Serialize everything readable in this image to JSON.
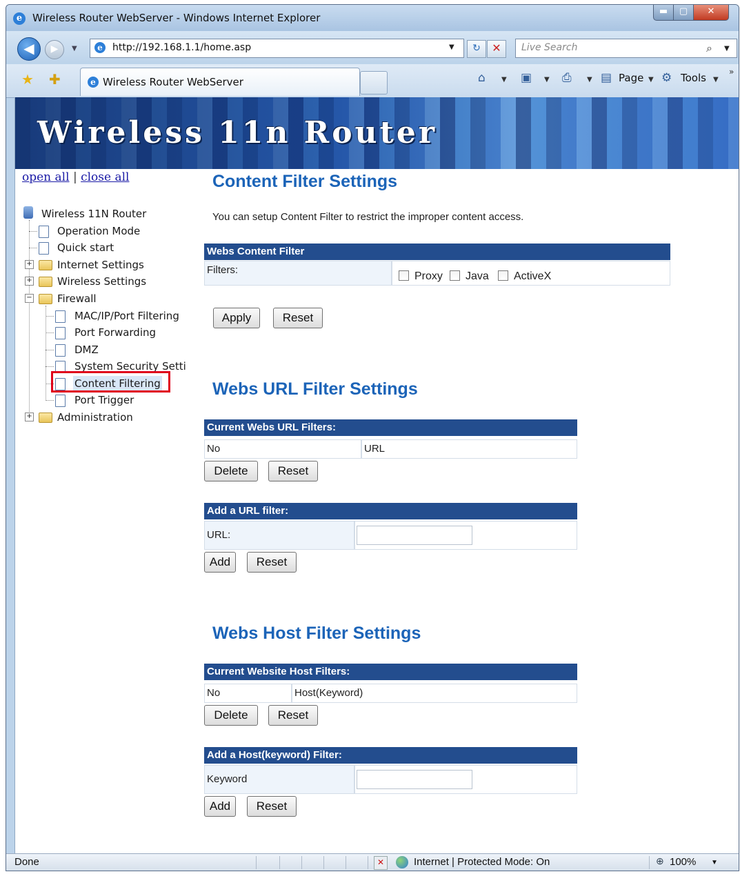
{
  "window": {
    "title": "Wireless Router WebServer - Windows Internet Explorer",
    "min_glyph": "▬",
    "max_glyph": "▢",
    "close_glyph": "✕"
  },
  "address_bar": {
    "url": "http://192.168.1.1/home.asp",
    "search_placeholder": "Live Search"
  },
  "tab": {
    "label": "Wireless Router WebServer"
  },
  "command_bar": {
    "page_label": "Page",
    "tools_label": "Tools"
  },
  "banner": {
    "title": "Wireless 11n Router"
  },
  "sidebar": {
    "open_all": "open all",
    "separator": "|",
    "close_all": "close all",
    "root": "Wireless 11N Router",
    "items": {
      "operation_mode": "Operation Mode",
      "quick_start": "Quick start",
      "internet_settings": "Internet Settings",
      "wireless_settings": "Wireless Settings",
      "firewall": "Firewall",
      "mac_ip_port": "MAC/IP/Port Filtering",
      "port_forwarding": "Port Forwarding",
      "dmz": "DMZ",
      "system_security": "System Security Setti",
      "content_filtering": "Content Filtering",
      "port_trigger": "Port Trigger",
      "administration": "Administration"
    },
    "selected": "Content Filtering"
  },
  "content_filter": {
    "title": "Content Filter Settings",
    "description": "You can setup Content Filter to restrict the improper content access.",
    "table_header": "Webs Content Filter",
    "filters_label": "Filters:",
    "options": [
      "Proxy",
      "Java",
      "ActiveX"
    ],
    "apply_label": "Apply",
    "reset_label": "Reset"
  },
  "url_filter": {
    "title": "Webs URL Filter Settings",
    "current_header": "Current Webs URL Filters:",
    "col_no": "No",
    "col_url": "URL",
    "delete_label": "Delete",
    "reset_label": "Reset",
    "add_header": "Add a URL filter:",
    "url_label": "URL:",
    "url_value": "",
    "add_label": "Add",
    "add_reset_label": "Reset"
  },
  "host_filter": {
    "title": "Webs Host Filter Settings",
    "current_header": "Current Website Host Filters:",
    "col_no": "No",
    "col_host": "Host(Keyword)",
    "delete_label": "Delete",
    "reset_label": "Reset",
    "add_header": "Add a Host(keyword) Filter:",
    "keyword_label": "Keyword",
    "keyword_value": "",
    "add_label": "Add",
    "add_reset_label": "Reset"
  },
  "status_bar": {
    "status": "Done",
    "zone": "Internet | Protected Mode: On",
    "zoom": "100%"
  }
}
